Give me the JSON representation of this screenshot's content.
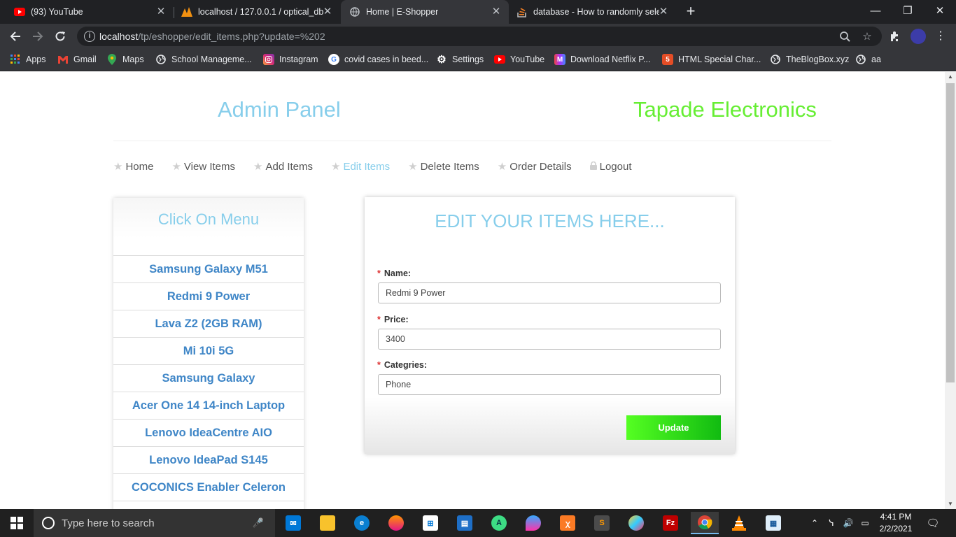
{
  "browser": {
    "tabs": [
      {
        "title": "(93) YouTube",
        "active": false
      },
      {
        "title": "localhost / 127.0.0.1 / optical_db",
        "active": false
      },
      {
        "title": "Home | E-Shopper",
        "active": true
      },
      {
        "title": "database - How to randomly sele",
        "active": false
      }
    ],
    "url_host": "localhost",
    "url_path": "/tp/eshopper/edit_items.php?update=%202",
    "bookmarks": [
      {
        "label": "Apps",
        "icon": "apps-grid-icon"
      },
      {
        "label": "Gmail",
        "icon": "gmail-icon"
      },
      {
        "label": "Maps",
        "icon": "maps-icon"
      },
      {
        "label": "School Manageme...",
        "icon": "globe-icon"
      },
      {
        "label": "Instagram",
        "icon": "instagram-icon"
      },
      {
        "label": "covid cases in beed...",
        "icon": "google-icon"
      },
      {
        "label": "Settings",
        "icon": "gear-icon"
      },
      {
        "label": "YouTube",
        "icon": "youtube-icon"
      },
      {
        "label": "Download Netflix P...",
        "icon": "netflix-icon"
      },
      {
        "label": "HTML Special Char...",
        "icon": "html-icon"
      },
      {
        "label": "TheBlogBox.xyz",
        "icon": "globe-icon"
      },
      {
        "label": "aa",
        "icon": "globe-icon"
      }
    ]
  },
  "page": {
    "admin_title": "Admin Panel",
    "brand_title": "Tapade Electronics",
    "nav": [
      {
        "label": "Home",
        "icon": "star-icon",
        "active": false
      },
      {
        "label": "View Items",
        "icon": "star-icon",
        "active": false
      },
      {
        "label": "Add Items",
        "icon": "star-icon",
        "active": false
      },
      {
        "label": "Edit Items",
        "icon": "star-icon",
        "active": true
      },
      {
        "label": "Delete Items",
        "icon": "star-icon",
        "active": false
      },
      {
        "label": "Order Details",
        "icon": "star-icon",
        "active": false
      },
      {
        "label": "Logout",
        "icon": "lock-icon",
        "active": false
      }
    ],
    "menu_title": "Click On Menu",
    "menu_items": [
      "Samsung Galaxy M51",
      "Redmi 9 Power",
      "Lava Z2 (2GB RAM)",
      "Mi 10i 5G",
      "Samsung Galaxy",
      "Acer One 14 14-inch Laptop",
      "Lenovo IdeaCentre AIO",
      "Lenovo IdeaPad S145",
      "COCONICS Enabler Celeron"
    ],
    "form": {
      "title": "EDIT YOUR ITEMS HERE...",
      "required_mark": "*",
      "name_label": "Name:",
      "name_value": "Redmi 9 Power",
      "price_label": "Price:",
      "price_value": "3400",
      "category_label": "Categries:",
      "category_value": "Phone",
      "submit_label": "Update"
    }
  },
  "taskbar": {
    "search_placeholder": "Type here to search",
    "time": "4:41 PM",
    "date": "2/2/2021"
  },
  "colors": {
    "accent_blue": "#87ceeb",
    "brand_green": "#66ee33",
    "menu_link": "#3f86c7",
    "button_green": "#33dd11"
  }
}
